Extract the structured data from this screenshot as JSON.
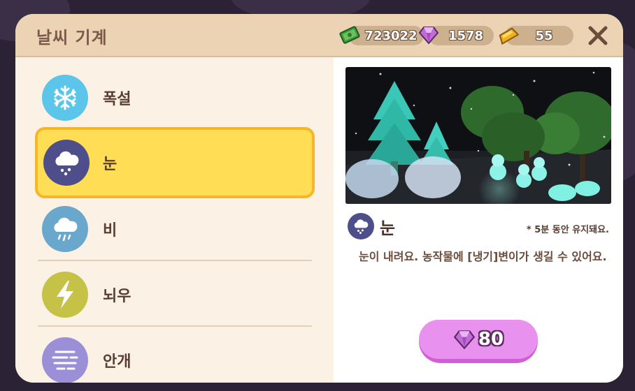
{
  "window": {
    "title": "날씨 기계"
  },
  "currencies": {
    "cash": {
      "icon": "cash-icon",
      "value": "723022"
    },
    "gem": {
      "icon": "gem-icon",
      "value": "1578"
    },
    "gold": {
      "icon": "gold-bar-icon",
      "value": "55"
    }
  },
  "weather_list": [
    {
      "label": "폭설",
      "icon": "snowflake-icon",
      "color": "#5cc6ea"
    },
    {
      "label": "눈",
      "icon": "snow-cloud-icon",
      "color": "#4e4e8a",
      "selected": true
    },
    {
      "label": "비",
      "icon": "rain-cloud-icon",
      "color": "#6aa7cc"
    },
    {
      "label": "뇌우",
      "icon": "lightning-icon",
      "color": "#c5c247"
    },
    {
      "label": "안개",
      "icon": "fog-icon",
      "color": "#9b8fd8"
    }
  ],
  "detail": {
    "icon": "snow-cloud-icon",
    "title": "눈",
    "note": "* 5분 동안 유지돼요.",
    "description": "눈이 내려요. 농작물에 [냉기]변이가 생길 수 있어요."
  },
  "buy_button": {
    "icon": "gem-icon",
    "price": "80"
  },
  "colors": {
    "accent": "#ffdd55",
    "buy": "#e891ee",
    "header": "#ecd3b3"
  }
}
